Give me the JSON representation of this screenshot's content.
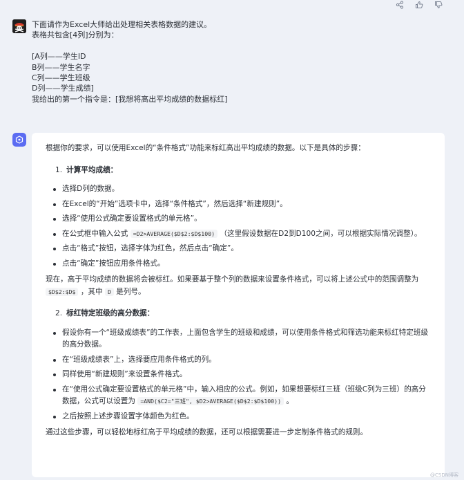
{
  "toolbar": {
    "share_icon": "share-icon",
    "like_icon": "thumbs-up-icon",
    "dislike_icon": "thumbs-down-icon"
  },
  "user_message": {
    "lines": [
      "下面请作为Excel大师给出处理相关表格数据的建议。",
      "表格共包含[4列]分别为：",
      "",
      "[A列——学生ID",
      "B列——学生名字",
      "C列——学生班级",
      "D列——学生成绩]",
      "我给出的第一个指令是：[我想将高出平均成绩的数据标红]"
    ]
  },
  "reply": {
    "intro": "根据你的要求，可以使用Excel的“条件格式”功能来标红高出平均成绩的数据。以下是具体的步骤：",
    "section1": {
      "num": "1.",
      "title": "计算平均成绩：",
      "items": [
        "选择D列的数据。",
        "在Excel的“开始”选项卡中，选择“条件格式”，然后选择“新建规则”。",
        "选择“使用公式确定要设置格式的单元格”。"
      ],
      "formula_item": {
        "before": "在公式框中输入公式",
        "code": "=D2>AVERAGE($D$2:$D$100)",
        "after": "（这里假设数据在D2到D100之间，可以根据实际情况调整）。"
      },
      "items2": [
        "点击“格式”按钮，选择字体为红色，然后点击“确定”。",
        "点击“确定”按钮应用条件格式。"
      ]
    },
    "mid": {
      "before": "现在，高于平均成绩的数据将会被标红。如果要基于整个列的数据来设置条件格式，可以将上述公式中的范围调整为",
      "code1": "$D$2:$D$",
      "middle": "，其中",
      "code2": "D",
      "after": "是列号。"
    },
    "section2": {
      "num": "2.",
      "title": "标红特定班级的高分数据：",
      "items": [
        "假设你有一个“班级成绩表”的工作表，上面包含学生的班级和成绩，可以使用条件格式和筛选功能来标红特定班级的高分数据。",
        "在“班级成绩表”上，选择要应用条件格式的列。",
        "同样使用“新建规则”来设置条件格式。"
      ],
      "formula_item": {
        "before": "在“使用公式确定要设置格式的单元格”中，输入相应的公式。例如，如果想要标红三班（班级C列为三班）的高分数据，公式可以设置为",
        "code": "=AND($C2=\"三班\", $D2>AVERAGE($D$2:$D$100))",
        "after": "。"
      },
      "items2": [
        "之后按照上述步骤设置字体颜色为红色。"
      ]
    },
    "outro": "通过这些步骤，可以轻松地标红高于平均成绩的数据，还可以根据需要进一步定制条件格式的规则。"
  },
  "watermark": "@CSDN博客",
  "colors": {
    "background": "#eef1f7",
    "card": "#ffffff",
    "bot_icon": "#5b6cf2"
  }
}
